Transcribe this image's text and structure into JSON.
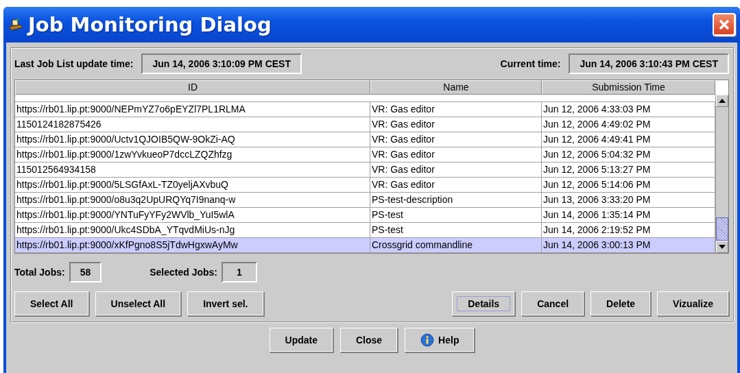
{
  "window": {
    "title": "Job Monitoring Dialog"
  },
  "last_update": {
    "label": "Last Job List update time:",
    "value": "Jun 14, 2006 3:10:09 PM CEST"
  },
  "current_time": {
    "label": "Current time:",
    "value": "Jun 14, 2006 3:10:43 PM CEST"
  },
  "table": {
    "columns": [
      "ID",
      "Name",
      "Submission Time"
    ],
    "rows": [
      {
        "cells": [
          "https://rb01.lip.pt:9000/NEPmYZ7o6pEYZl7PL1RLMA",
          "VR: Gas editor",
          "Jun 12, 2006 4:33:03 PM"
        ],
        "selected": false
      },
      {
        "cells": [
          "1150124182875426",
          "VR: Gas editor",
          "Jun 12, 2006 4:49:02 PM"
        ],
        "selected": false
      },
      {
        "cells": [
          "https://rb01.lip.pt:9000/Uctv1QJOIB5QW-9OkZi-AQ",
          "VR: Gas editor",
          "Jun 12, 2006 4:49:41 PM"
        ],
        "selected": false
      },
      {
        "cells": [
          "https://rb01.lip.pt:9000/1zwYvkueoP7dccLZQZhfzg",
          "VR: Gas editor",
          "Jun 12, 2006 5:04:32 PM"
        ],
        "selected": false
      },
      {
        "cells": [
          "115012564934158",
          "VR: Gas editor",
          "Jun 12, 2006 5:13:27 PM"
        ],
        "selected": false
      },
      {
        "cells": [
          "https://rb01.lip.pt:9000/5LSGfAxL-TZ0yeljAXvbuQ",
          "VR: Gas editor",
          "Jun 12, 2006 5:14:06 PM"
        ],
        "selected": false
      },
      {
        "cells": [
          "https://rb01.lip.pt:9000/o8u3q2UpURQYq7I9nanq-w",
          "PS-test-description",
          "Jun 13, 2006 3:33:20 PM"
        ],
        "selected": false
      },
      {
        "cells": [
          "https://rb01.lip.pt:9000/YNTuFyYFy2WVlb_YuI5wlA",
          "PS-test",
          "Jun 14, 2006 1:35:14 PM"
        ],
        "selected": false
      },
      {
        "cells": [
          "https://rb01.lip.pt:9000/Ukc4SDbA_YTqvdMiUs-nJg",
          "PS-test",
          "Jun 14, 2006 2:19:52 PM"
        ],
        "selected": false
      },
      {
        "cells": [
          "https://rb01.lip.pt:9000/xKfPgno8S5jTdwHgxwAyMw",
          "Crossgrid commandline",
          "Jun 14, 2006 3:00:13 PM"
        ],
        "selected": true
      }
    ]
  },
  "total_jobs": {
    "label": "Total Jobs:",
    "value": "58"
  },
  "selected_jobs": {
    "label": "Selected Jobs:",
    "value": "1"
  },
  "selection_buttons": [
    {
      "label": "Select All",
      "focused": false
    },
    {
      "label": "Unselect All",
      "focused": false
    },
    {
      "label": "Invert sel.",
      "focused": false
    }
  ],
  "job_buttons": [
    {
      "label": "Details",
      "focused": true
    },
    {
      "label": "Cancel",
      "focused": false
    },
    {
      "label": "Delete",
      "focused": false
    },
    {
      "label": "Vizualize",
      "focused": false
    }
  ],
  "dialog_buttons": [
    {
      "label": "Update",
      "kind": "plain"
    },
    {
      "label": "Close",
      "kind": "plain"
    },
    {
      "label": "Help",
      "kind": "help"
    }
  ]
}
